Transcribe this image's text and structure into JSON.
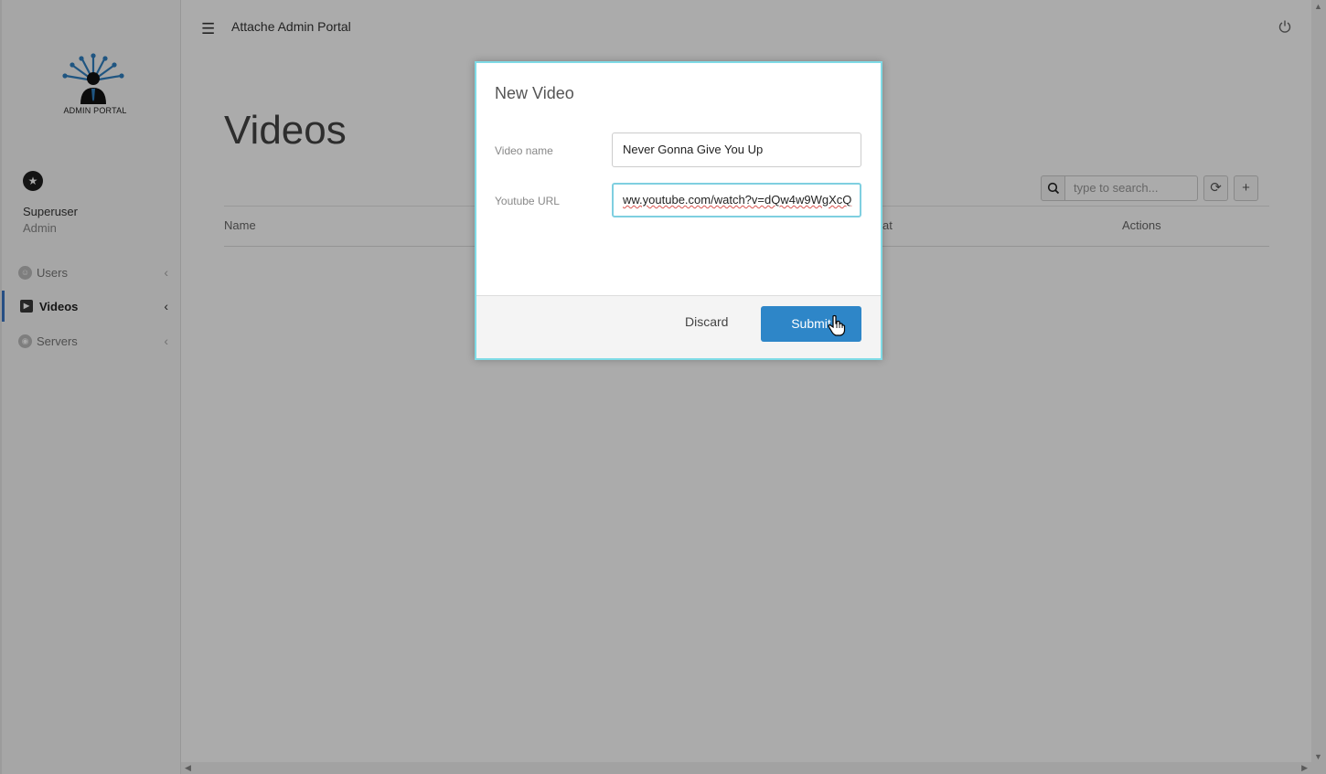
{
  "app": {
    "title": "Attache Admin Portal"
  },
  "sidebar": {
    "logo_text": "ADMIN PORTAL",
    "user": {
      "name": "Superuser",
      "role": "Admin"
    },
    "items": [
      {
        "label": "Users",
        "icon": "users-icon",
        "active": false
      },
      {
        "label": "Videos",
        "icon": "video-icon",
        "active": true
      },
      {
        "label": "Servers",
        "icon": "servers-icon",
        "active": false
      }
    ]
  },
  "main": {
    "page_title": "Videos",
    "search": {
      "placeholder": "type to search..."
    },
    "table": {
      "columns": [
        "Name",
        "at",
        "Actions"
      ]
    }
  },
  "modal": {
    "title": "New Video",
    "fields": [
      {
        "label": "Video name",
        "value": "Never Gonna Give You Up"
      },
      {
        "label": "Youtube URL",
        "value": "ww.youtube.com/watch?v=dQw4w9WgXcQ"
      }
    ],
    "discard_label": "Discard",
    "submit_label": "Submit"
  },
  "colors": {
    "accent": "#2e86c8",
    "focus_border": "#7fdbe6",
    "active_nav": "#3b76c5"
  }
}
